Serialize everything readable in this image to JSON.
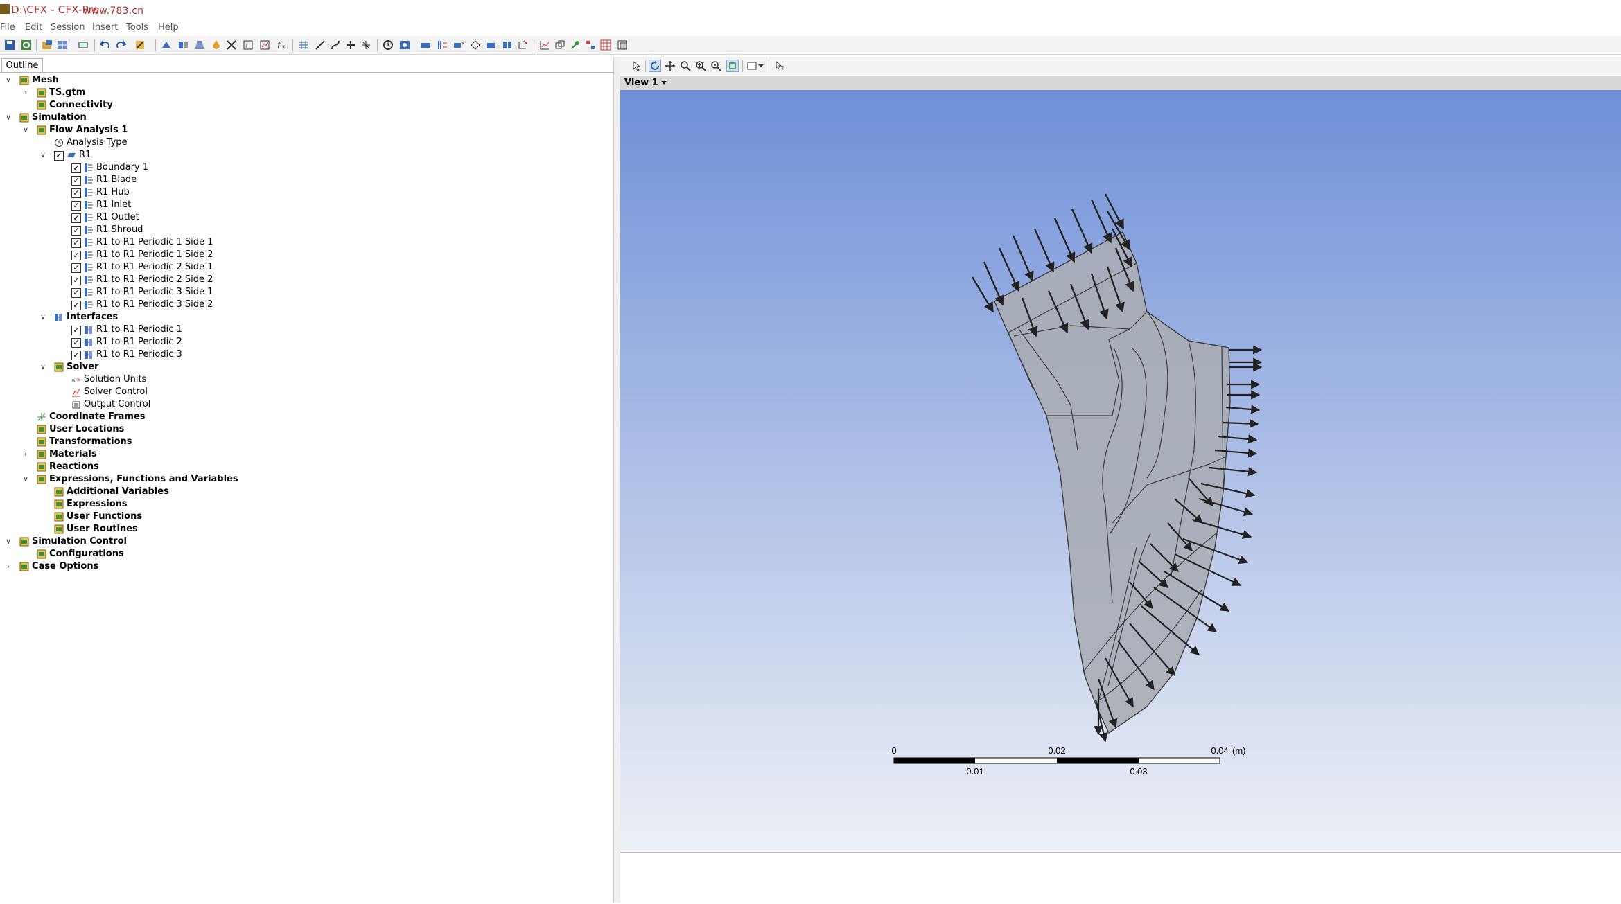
{
  "window": {
    "title": "D:\\CFX - CFX-Pre",
    "watermark": "www.783.cn"
  },
  "menu": [
    "File",
    "Edit",
    "Session",
    "Insert",
    "Tools",
    "Help"
  ],
  "outline": {
    "tab_label": "Outline",
    "items": [
      {
        "label": "Mesh",
        "bold": true,
        "level": 0,
        "expander": "v",
        "icon": "mesh-folder-icon"
      },
      {
        "label": "TS.gtm",
        "bold": true,
        "level": 1,
        "expander": ">",
        "icon": "mesh-file-icon"
      },
      {
        "label": "Connectivity",
        "bold": true,
        "level": 1,
        "expander": "",
        "icon": "connectivity-icon"
      },
      {
        "label": "Simulation",
        "bold": true,
        "level": 0,
        "expander": "v",
        "icon": "simulation-icon"
      },
      {
        "label": "Flow Analysis 1",
        "bold": true,
        "level": 1,
        "expander": "v",
        "icon": "flow-analysis-icon"
      },
      {
        "label": "Analysis Type",
        "bold": false,
        "level": 2,
        "expander": "",
        "icon": "clock-icon"
      },
      {
        "label": "R1",
        "bold": false,
        "level": 2,
        "expander": "v",
        "checkbox": true,
        "icon": "domain-icon"
      },
      {
        "label": "Boundary 1",
        "bold": false,
        "level": 3,
        "checkbox": true,
        "icon": "boundary-icon"
      },
      {
        "label": "R1 Blade",
        "bold": false,
        "level": 3,
        "checkbox": true,
        "icon": "boundary-icon"
      },
      {
        "label": "R1 Hub",
        "bold": false,
        "level": 3,
        "checkbox": true,
        "icon": "boundary-icon"
      },
      {
        "label": "R1 Inlet",
        "bold": false,
        "level": 3,
        "checkbox": true,
        "icon": "boundary-icon"
      },
      {
        "label": "R1 Outlet",
        "bold": false,
        "level": 3,
        "checkbox": true,
        "icon": "boundary-icon"
      },
      {
        "label": "R1 Shroud",
        "bold": false,
        "level": 3,
        "checkbox": true,
        "icon": "boundary-icon"
      },
      {
        "label": "R1 to R1 Periodic 1 Side 1",
        "bold": false,
        "level": 3,
        "checkbox": true,
        "icon": "boundary-icon"
      },
      {
        "label": "R1 to R1 Periodic 1 Side 2",
        "bold": false,
        "level": 3,
        "checkbox": true,
        "icon": "boundary-icon"
      },
      {
        "label": "R1 to R1 Periodic 2 Side 1",
        "bold": false,
        "level": 3,
        "checkbox": true,
        "icon": "boundary-icon"
      },
      {
        "label": "R1 to R1 Periodic 2 Side 2",
        "bold": false,
        "level": 3,
        "checkbox": true,
        "icon": "boundary-icon"
      },
      {
        "label": "R1 to R1 Periodic 3 Side 1",
        "bold": false,
        "level": 3,
        "checkbox": true,
        "icon": "boundary-icon"
      },
      {
        "label": "R1 to R1 Periodic 3 Side 2",
        "bold": false,
        "level": 3,
        "checkbox": true,
        "icon": "boundary-icon"
      },
      {
        "label": "Interfaces",
        "bold": true,
        "level": 2,
        "expander": "v",
        "icon": "interfaces-icon"
      },
      {
        "label": "R1 to R1 Periodic 1",
        "bold": false,
        "level": 3,
        "checkbox": true,
        "icon": "interface-icon"
      },
      {
        "label": "R1 to R1 Periodic 2",
        "bold": false,
        "level": 3,
        "checkbox": true,
        "icon": "interface-icon"
      },
      {
        "label": "R1 to R1 Periodic 3",
        "bold": false,
        "level": 3,
        "checkbox": true,
        "icon": "interface-icon"
      },
      {
        "label": "Solver",
        "bold": true,
        "level": 2,
        "expander": "v",
        "icon": "solver-icon"
      },
      {
        "label": "Solution Units",
        "bold": false,
        "level": 3,
        "icon": "units-icon"
      },
      {
        "label": "Solver Control",
        "bold": false,
        "level": 3,
        "icon": "solver-control-icon"
      },
      {
        "label": "Output Control",
        "bold": false,
        "level": 3,
        "icon": "output-control-icon"
      },
      {
        "label": "Coordinate Frames",
        "bold": true,
        "level": 1,
        "icon": "coordinate-frames-icon"
      },
      {
        "label": "User Locations",
        "bold": true,
        "level": 1,
        "icon": "user-locations-icon"
      },
      {
        "label": "Transformations",
        "bold": true,
        "level": 1,
        "icon": "transformations-icon"
      },
      {
        "label": "Materials",
        "bold": true,
        "level": 1,
        "expander": ">",
        "icon": "materials-icon"
      },
      {
        "label": "Reactions",
        "bold": true,
        "level": 1,
        "icon": "reactions-icon"
      },
      {
        "label": "Expressions, Functions and Variables",
        "bold": true,
        "level": 1,
        "expander": "v",
        "icon": "expressions-folder-icon"
      },
      {
        "label": "Additional Variables",
        "bold": true,
        "level": 2,
        "icon": "additional-variables-icon"
      },
      {
        "label": "Expressions",
        "bold": true,
        "level": 2,
        "icon": "expressions-icon"
      },
      {
        "label": "User Functions",
        "bold": true,
        "level": 2,
        "icon": "user-functions-icon"
      },
      {
        "label": "User Routines",
        "bold": true,
        "level": 2,
        "icon": "user-routines-icon"
      },
      {
        "label": "Simulation Control",
        "bold": true,
        "level": 0,
        "expander": "v",
        "icon": "simulation-control-icon"
      },
      {
        "label": "Configurations",
        "bold": true,
        "level": 1,
        "icon": "configurations-icon"
      },
      {
        "label": "Case Options",
        "bold": true,
        "level": 0,
        "expander": ">",
        "icon": "case-options-icon"
      }
    ]
  },
  "viewer": {
    "view_name": "View 1",
    "scale": {
      "top_labels": [
        "0",
        "0.02",
        "0.04"
      ],
      "bottom_labels": [
        "0.01",
        "0.03"
      ],
      "unit": "(m)"
    }
  },
  "colors": {
    "viewport_top": "#6f90d8",
    "viewport_bottom": "#eef0f6",
    "geometry_fill": "#a9adb5",
    "arrow": "#222222"
  }
}
